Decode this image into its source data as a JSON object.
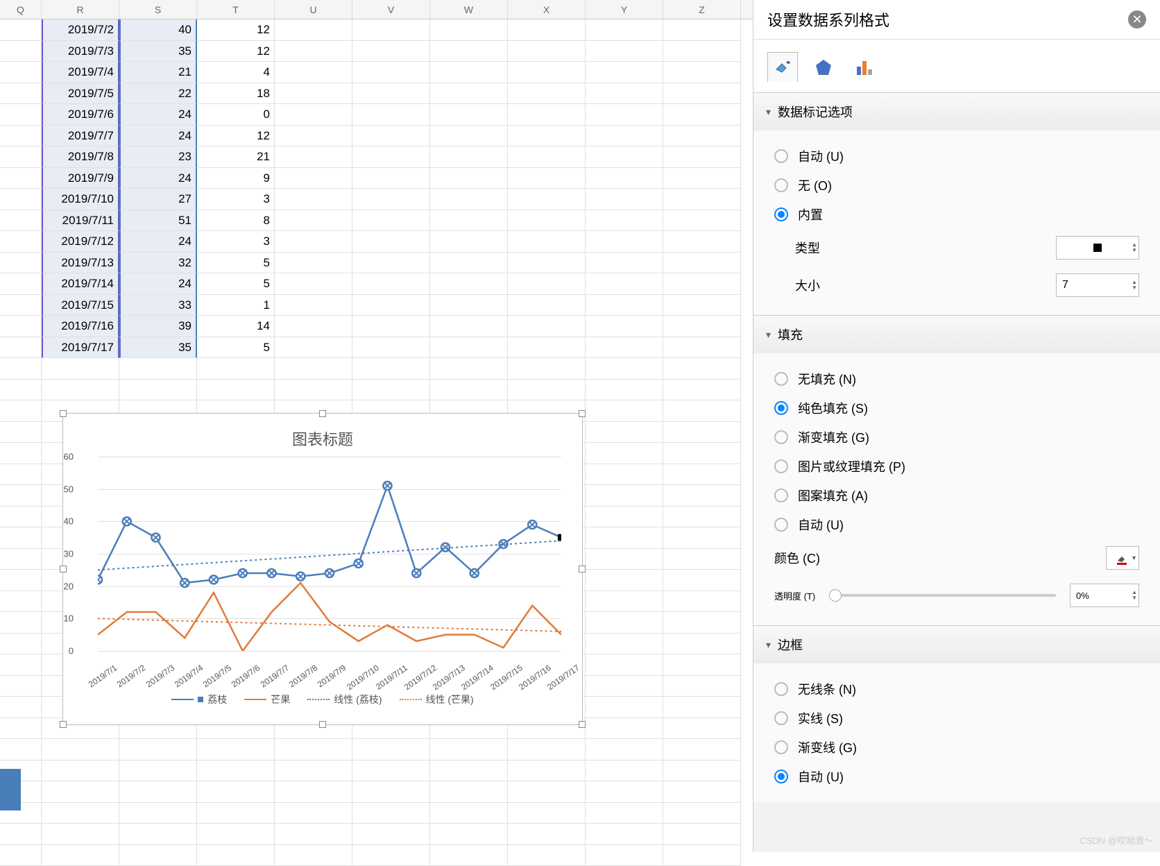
{
  "columns": [
    "Q",
    "R",
    "S",
    "T",
    "U",
    "V",
    "W",
    "X",
    "Y",
    "Z"
  ],
  "rows": [
    {
      "r": "2019/7/2",
      "s": "40",
      "t": "12"
    },
    {
      "r": "2019/7/3",
      "s": "35",
      "t": "12"
    },
    {
      "r": "2019/7/4",
      "s": "21",
      "t": "4"
    },
    {
      "r": "2019/7/5",
      "s": "22",
      "t": "18"
    },
    {
      "r": "2019/7/6",
      "s": "24",
      "t": "0"
    },
    {
      "r": "2019/7/7",
      "s": "24",
      "t": "12"
    },
    {
      "r": "2019/7/8",
      "s": "23",
      "t": "21"
    },
    {
      "r": "2019/7/9",
      "s": "24",
      "t": "9"
    },
    {
      "r": "2019/7/10",
      "s": "27",
      "t": "3"
    },
    {
      "r": "2019/7/11",
      "s": "51",
      "t": "8"
    },
    {
      "r": "2019/7/12",
      "s": "24",
      "t": "3"
    },
    {
      "r": "2019/7/13",
      "s": "32",
      "t": "5"
    },
    {
      "r": "2019/7/14",
      "s": "24",
      "t": "5"
    },
    {
      "r": "2019/7/15",
      "s": "33",
      "t": "1"
    },
    {
      "r": "2019/7/16",
      "s": "39",
      "t": "14"
    },
    {
      "r": "2019/7/17",
      "s": "35",
      "t": "5"
    }
  ],
  "chart": {
    "title": "图表标题",
    "legend": [
      "荔枝",
      "芒果",
      "线性 (荔枝)",
      "线性 (芒果)"
    ]
  },
  "chart_data": {
    "type": "line",
    "title": "图表标题",
    "xlabel": "",
    "ylabel": "",
    "ylim": [
      0,
      60
    ],
    "yticks": [
      0,
      10,
      20,
      30,
      40,
      50,
      60
    ],
    "categories": [
      "2019/7/1",
      "2019/7/2",
      "2019/7/3",
      "2019/7/4",
      "2019/7/5",
      "2019/7/6",
      "2019/7/7",
      "2019/7/8",
      "2019/7/9",
      "2019/7/10",
      "2019/7/11",
      "2019/7/12",
      "2019/7/13",
      "2019/7/14",
      "2019/7/15",
      "2019/7/16",
      "2019/7/17"
    ],
    "series": [
      {
        "name": "荔枝",
        "color": "#4a7ebb",
        "values": [
          22,
          40,
          35,
          21,
          22,
          24,
          24,
          23,
          24,
          27,
          51,
          24,
          32,
          24,
          33,
          39,
          35
        ]
      },
      {
        "name": "芒果",
        "color": "#e07b3c",
        "values": [
          5,
          12,
          12,
          4,
          18,
          0,
          12,
          21,
          9,
          3,
          8,
          3,
          5,
          5,
          1,
          14,
          5
        ]
      },
      {
        "name": "线性 (荔枝)",
        "type": "trendline",
        "color": "#4a7ebb",
        "start": 25,
        "end": 34
      },
      {
        "name": "线性 (芒果)",
        "type": "trendline",
        "color": "#e07b3c",
        "start": 10,
        "end": 6
      }
    ]
  },
  "panel": {
    "title": "设置数据系列格式",
    "sections": {
      "marker": {
        "title": "数据标记选项",
        "opts": {
          "auto": "自动 (U)",
          "none": "无 (O)",
          "builtin": "内置"
        },
        "type_label": "类型",
        "size_label": "大小",
        "size_value": "7"
      },
      "fill": {
        "title": "填充",
        "opts": {
          "none": "无填充 (N)",
          "solid": "纯色填充 (S)",
          "gradient": "渐变填充 (G)",
          "picture": "图片或纹理填充 (P)",
          "pattern": "图案填充 (A)",
          "auto": "自动 (U)"
        },
        "color_label": "颜色 (C)",
        "transparency_label": "透明度 (T)",
        "transparency_value": "0%"
      },
      "border": {
        "title": "边框",
        "opts": {
          "none": "无线条 (N)",
          "solid": "实线 (S)",
          "gradient": "渐变线 (G)",
          "auto": "自动 (U)"
        }
      }
    }
  },
  "watermark": "CSDN @哎呦激～"
}
